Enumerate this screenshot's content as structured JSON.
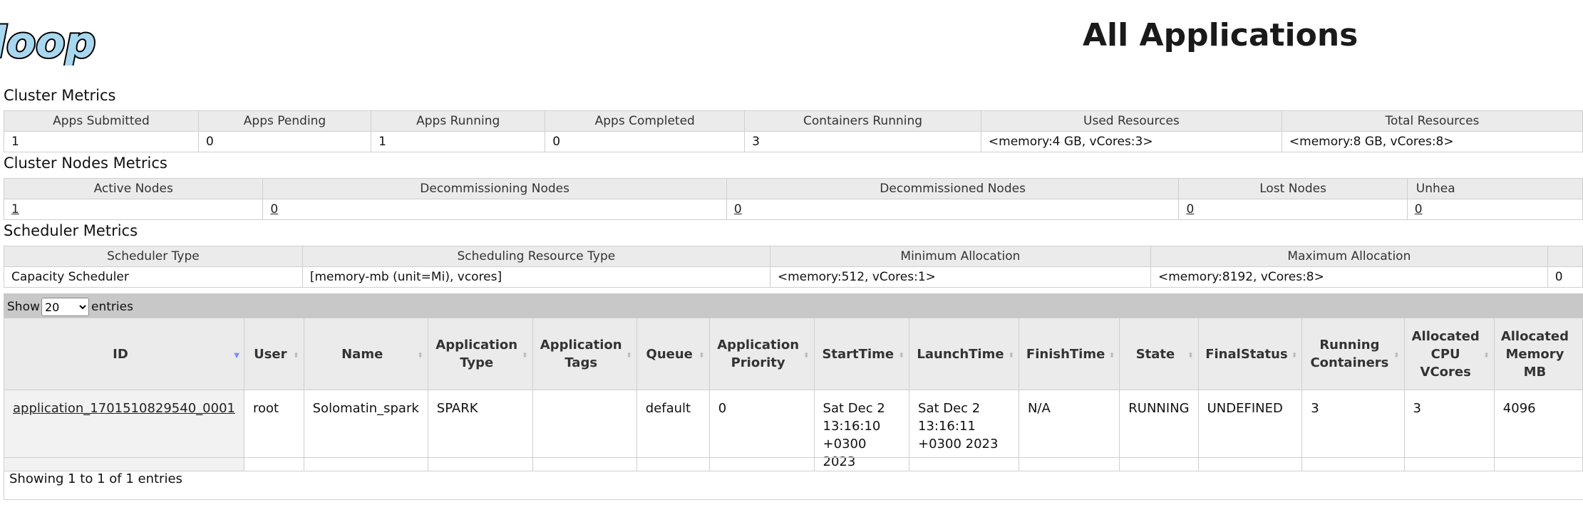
{
  "header": {
    "logo_text": "doop",
    "title": "All Applications"
  },
  "cluster_metrics": {
    "title": "Cluster Metrics",
    "headers": [
      "Apps Submitted",
      "Apps Pending",
      "Apps Running",
      "Apps Completed",
      "Containers Running",
      "Used Resources",
      "Total Resources"
    ],
    "values": [
      "1",
      "0",
      "1",
      "0",
      "3",
      "<memory:4 GB, vCores:3>",
      "<memory:8 GB, vCores:8>"
    ]
  },
  "cluster_nodes_metrics": {
    "title": "Cluster Nodes Metrics",
    "headers": [
      "Active Nodes",
      "Decommissioning Nodes",
      "Decommissioned Nodes",
      "Lost Nodes",
      "Unhea"
    ],
    "values": [
      "1",
      "0",
      "0",
      "0",
      "0"
    ]
  },
  "scheduler_metrics": {
    "title": "Scheduler Metrics",
    "headers": [
      "Scheduler Type",
      "Scheduling Resource Type",
      "Minimum Allocation",
      "Maximum Allocation"
    ],
    "values": [
      "Capacity Scheduler",
      "[memory-mb (unit=Mi), vcores]",
      "<memory:512, vCores:1>",
      "<memory:8192, vCores:8>",
      "0"
    ]
  },
  "entries_control": {
    "show_label": "Show",
    "selected": "20",
    "entries_label": "entries"
  },
  "apps_table": {
    "headers": [
      "ID",
      "User",
      "Name",
      "Application Type",
      "Application Tags",
      "Queue",
      "Application Priority",
      "StartTime",
      "LaunchTime",
      "FinishTime",
      "State",
      "FinalStatus",
      "Running Containers",
      "Allocated CPU VCores",
      "Allocated Memory MB"
    ],
    "rows": [
      {
        "id": "application_1701510829540_0001",
        "user": "root",
        "name": "Solomatin_spark",
        "type": "SPARK",
        "tags": "",
        "queue": "default",
        "priority": "0",
        "start_time": "Sat Dec 2 13:16:10 +0300 2023",
        "launch_time": "Sat Dec 2 13:16:11 +0300 2023",
        "finish_time": "N/A",
        "state": "RUNNING",
        "final_status": "UNDEFINED",
        "running_containers": "3",
        "allocated_vcores": "3",
        "allocated_memory": "4096"
      }
    ]
  },
  "info": {
    "text": "Showing 1 to 1 of 1 entries"
  },
  "colors": {
    "header_bg": "#ebebeb",
    "toolbar_bg": "#c8c8c8",
    "logo_fill": "#a8d8f0",
    "sort_active": "#7a8cff"
  }
}
